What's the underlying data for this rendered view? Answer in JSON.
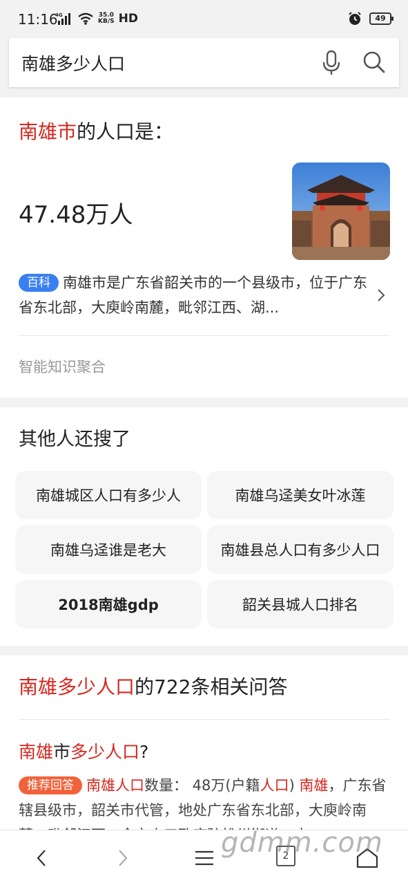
{
  "status_bar": {
    "time": "11:16",
    "net_speed_value": "35.0",
    "net_speed_unit": "KB/S",
    "hd": "HD",
    "battery": "49"
  },
  "search": {
    "query": "南雄多少人口"
  },
  "answer": {
    "title_highlight": "南雄市",
    "title_rest": "的人口是：",
    "value": "47.48万人",
    "baike_tag": "百科",
    "baike_text": "南雄市是广东省韶关市的一个县级市，位于广东省东北部，大庾岭南麓，毗邻江西、湖...",
    "source": "智能知识聚合"
  },
  "related": {
    "title": "其他人还搜了",
    "items": [
      "南雄城区人口有多少人",
      "南雄乌迳美女叶冰莲",
      "南雄乌迳谁是老大",
      "南雄县总人口有多少人口",
      "2018南雄gdp",
      "韶关县城人口排名"
    ]
  },
  "qa": {
    "title_highlight": "南雄多少人口",
    "title_rest": "的722条相关问答",
    "question_part1": "南雄",
    "question_part2": "市",
    "question_part3": "多少人口",
    "question_part4": "?",
    "rec_tag": "推荐回答",
    "answer_hl1": "南雄人口",
    "answer_t1": "数量： 48万(户籍",
    "answer_hl2": "人口",
    "answer_t2": ") ",
    "answer_hl3": "南雄",
    "answer_t3": "，广东省辖县级市，韶关市代管，地处广东省东北部，大庾岭南麓，毗邻江西，全市人口政府驻雄州街道，户"
  },
  "bottom_nav": {
    "tab_count": "2",
    "watermark": "gdmm.com"
  },
  "colors": {
    "highlight": "#d8261d",
    "baike_tag": "#3a7ff2",
    "rec_tag": "#f2623a"
  }
}
